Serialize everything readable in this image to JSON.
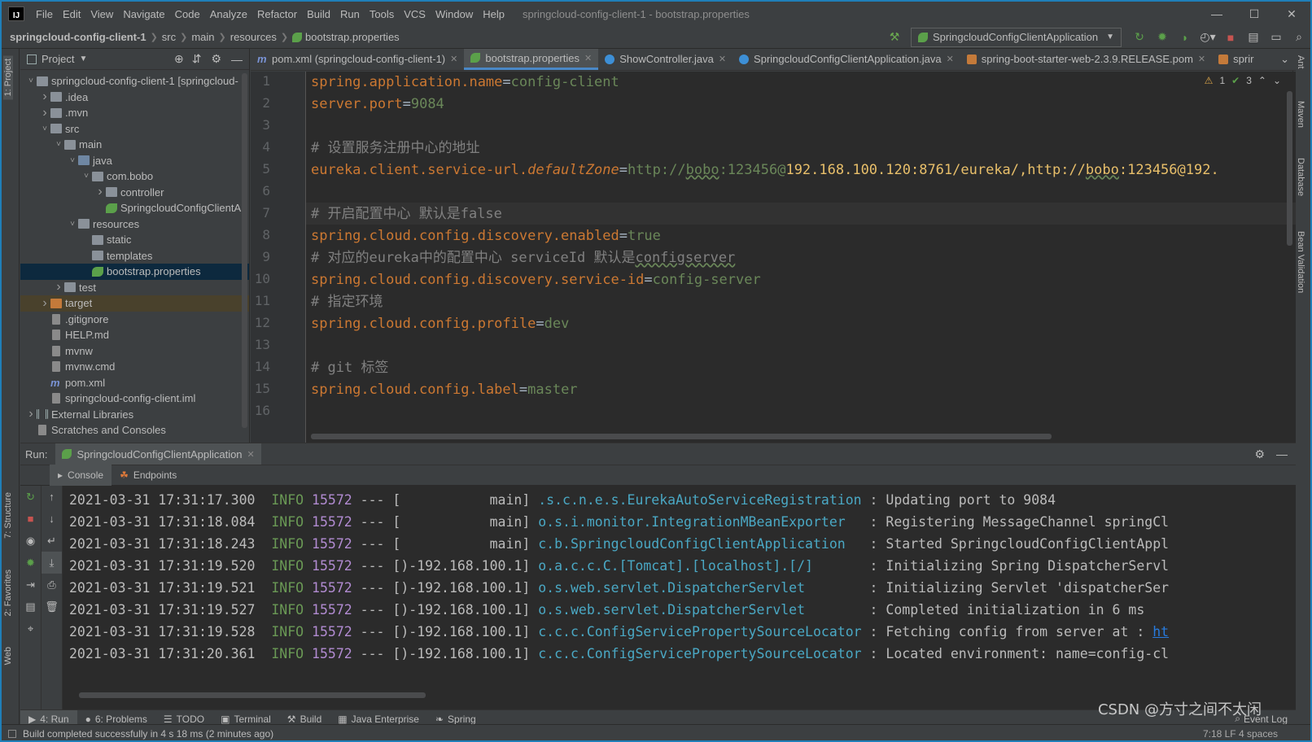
{
  "app": {
    "icon_text": "IJ",
    "window_title": "springcloud-config-client-1 - bootstrap.properties"
  },
  "menu": [
    "File",
    "Edit",
    "View",
    "Navigate",
    "Code",
    "Analyze",
    "Refactor",
    "Build",
    "Run",
    "Tools",
    "VCS",
    "Window",
    "Help"
  ],
  "breadcrumb": [
    "springcloud-config-client-1",
    "src",
    "main",
    "resources",
    "bootstrap.properties"
  ],
  "run_config": "SpringcloudConfigClientApplication",
  "project_panel": {
    "title": "Project",
    "tree": [
      {
        "label": "springcloud-config-client-1 [springcloud-",
        "depth": 0,
        "arrow": "v",
        "icon": "folder"
      },
      {
        "label": ".idea",
        "depth": 1,
        "arrow": ">",
        "icon": "folder"
      },
      {
        "label": ".mvn",
        "depth": 1,
        "arrow": ">",
        "icon": "folder"
      },
      {
        "label": "src",
        "depth": 1,
        "arrow": "v",
        "icon": "folder"
      },
      {
        "label": "main",
        "depth": 2,
        "arrow": "v",
        "icon": "folder"
      },
      {
        "label": "java",
        "depth": 3,
        "arrow": "v",
        "icon": "src"
      },
      {
        "label": "com.bobo",
        "depth": 4,
        "arrow": "v",
        "icon": "folder"
      },
      {
        "label": "controller",
        "depth": 5,
        "arrow": ">",
        "icon": "folder"
      },
      {
        "label": "SpringcloudConfigClientAp",
        "depth": 5,
        "arrow": "",
        "icon": "leaf"
      },
      {
        "label": "resources",
        "depth": 3,
        "arrow": "v",
        "icon": "folder"
      },
      {
        "label": "static",
        "depth": 4,
        "arrow": "",
        "icon": "folder"
      },
      {
        "label": "templates",
        "depth": 4,
        "arrow": "",
        "icon": "folder"
      },
      {
        "label": "bootstrap.properties",
        "depth": 4,
        "arrow": "",
        "icon": "leaf",
        "selected": true
      },
      {
        "label": "test",
        "depth": 2,
        "arrow": ">",
        "icon": "folder"
      },
      {
        "label": "target",
        "depth": 1,
        "arrow": ">",
        "icon": "orange",
        "excluded": true
      },
      {
        "label": ".gitignore",
        "depth": 1,
        "arrow": "",
        "icon": "file"
      },
      {
        "label": "HELP.md",
        "depth": 1,
        "arrow": "",
        "icon": "file"
      },
      {
        "label": "mvnw",
        "depth": 1,
        "arrow": "",
        "icon": "file"
      },
      {
        "label": "mvnw.cmd",
        "depth": 1,
        "arrow": "",
        "icon": "file"
      },
      {
        "label": "pom.xml",
        "depth": 1,
        "arrow": "",
        "icon": "mvn"
      },
      {
        "label": "springcloud-config-client.iml",
        "depth": 1,
        "arrow": "",
        "icon": "file"
      },
      {
        "label": "External Libraries",
        "depth": 0,
        "arrow": ">",
        "icon": "lib"
      },
      {
        "label": "Scratches and Consoles",
        "depth": 0,
        "arrow": "",
        "icon": "file"
      }
    ]
  },
  "editor_tabs": [
    {
      "label": "pom.xml (springcloud-config-client-1)",
      "icon": "m",
      "active": false
    },
    {
      "label": "bootstrap.properties",
      "icon": "leaf",
      "active": true
    },
    {
      "label": "ShowController.java",
      "icon": "c",
      "active": false
    },
    {
      "label": "SpringcloudConfigClientApplication.java",
      "icon": "c",
      "active": false
    },
    {
      "label": "spring-boot-starter-web-2.3.9.RELEASE.pom",
      "icon": "pom",
      "active": false
    },
    {
      "label": "sprir",
      "icon": "pom",
      "active": false
    }
  ],
  "editor_status": {
    "warnings": "1",
    "checks": "3"
  },
  "code_lines": [
    {
      "n": "1",
      "parts": [
        [
          "k",
          "spring.application.name"
        ],
        [
          "eq",
          "="
        ],
        [
          "v",
          "config-client"
        ]
      ]
    },
    {
      "n": "2",
      "parts": [
        [
          "k",
          "server.port"
        ],
        [
          "eq",
          "="
        ],
        [
          "v",
          "9084"
        ]
      ]
    },
    {
      "n": "3",
      "parts": []
    },
    {
      "n": "4",
      "parts": [
        [
          "c",
          "# 设置服务注册中心的地址"
        ]
      ]
    },
    {
      "n": "5",
      "parts": [
        [
          "k",
          "eureka.client.service-url."
        ],
        [
          "it",
          "defaultZone"
        ],
        [
          "eq",
          "="
        ],
        [
          "v",
          "http://"
        ],
        [
          "vu",
          "bobo"
        ],
        [
          "v",
          ":123456@"
        ],
        [
          "y",
          "192.168.100.120:8761/eureka/,http://"
        ],
        [
          "yu",
          "bobo"
        ],
        [
          "y",
          ":123456@192."
        ]
      ]
    },
    {
      "n": "6",
      "parts": []
    },
    {
      "n": "7",
      "parts": [
        [
          "c",
          "# 开启配置中心 默认是false"
        ]
      ]
    },
    {
      "n": "8",
      "parts": [
        [
          "k",
          "spring.cloud.config.discovery.enabled"
        ],
        [
          "eq",
          "="
        ],
        [
          "v",
          "true"
        ]
      ]
    },
    {
      "n": "9",
      "parts": [
        [
          "c",
          "# 对应的eureka中的配置中心 serviceId 默认是"
        ],
        [
          "cu",
          "configserver"
        ]
      ]
    },
    {
      "n": "10",
      "parts": [
        [
          "k",
          "spring.cloud.config.discovery.service-id"
        ],
        [
          "eq",
          "="
        ],
        [
          "v",
          "config-server"
        ]
      ]
    },
    {
      "n": "11",
      "parts": [
        [
          "c",
          "# 指定环境"
        ]
      ]
    },
    {
      "n": "12",
      "parts": [
        [
          "k",
          "spring.cloud.config.profile"
        ],
        [
          "eq",
          "="
        ],
        [
          "v",
          "dev"
        ]
      ]
    },
    {
      "n": "13",
      "parts": []
    },
    {
      "n": "14",
      "parts": [
        [
          "c",
          "# git 标签"
        ]
      ]
    },
    {
      "n": "15",
      "parts": [
        [
          "k",
          "spring.cloud.config.label"
        ],
        [
          "eq",
          "="
        ],
        [
          "v",
          "master"
        ]
      ]
    },
    {
      "n": "16",
      "parts": []
    }
  ],
  "run_panel": {
    "label": "Run:",
    "tab": "SpringcloudConfigClientApplication",
    "subtabs": [
      "Console",
      "Endpoints"
    ]
  },
  "log_lines": [
    {
      "ts": "2021-03-31 17:31:17.300",
      "lvl": "INFO",
      "pid": "15572",
      "sep": "---",
      "thread": "[           main]",
      "logger": ".s.c.n.e.s.EurekaAutoServiceRegistration",
      "msg": ": Updating port to 9084",
      "link": ""
    },
    {
      "ts": "2021-03-31 17:31:18.084",
      "lvl": "INFO",
      "pid": "15572",
      "sep": "---",
      "thread": "[           main]",
      "logger": "o.s.i.monitor.IntegrationMBeanExporter  ",
      "msg": ": Registering MessageChannel springCl",
      "link": ""
    },
    {
      "ts": "2021-03-31 17:31:18.243",
      "lvl": "INFO",
      "pid": "15572",
      "sep": "---",
      "thread": "[           main]",
      "logger": "c.b.SpringcloudConfigClientApplication  ",
      "msg": ": Started SpringcloudConfigClientAppl",
      "link": ""
    },
    {
      "ts": "2021-03-31 17:31:19.520",
      "lvl": "INFO",
      "pid": "15572",
      "sep": "---",
      "thread": "[)-192.168.100.1]",
      "logger": "o.a.c.c.C.[Tomcat].[localhost].[/]      ",
      "msg": ": Initializing Spring DispatcherServl",
      "link": ""
    },
    {
      "ts": "2021-03-31 17:31:19.521",
      "lvl": "INFO",
      "pid": "15572",
      "sep": "---",
      "thread": "[)-192.168.100.1]",
      "logger": "o.s.web.servlet.DispatcherServlet       ",
      "msg": ": Initializing Servlet 'dispatcherSer",
      "link": ""
    },
    {
      "ts": "2021-03-31 17:31:19.527",
      "lvl": "INFO",
      "pid": "15572",
      "sep": "---",
      "thread": "[)-192.168.100.1]",
      "logger": "o.s.web.servlet.DispatcherServlet       ",
      "msg": ": Completed initialization in 6 ms",
      "link": ""
    },
    {
      "ts": "2021-03-31 17:31:19.528",
      "lvl": "INFO",
      "pid": "15572",
      "sep": "---",
      "thread": "[)-192.168.100.1]",
      "logger": "c.c.c.ConfigServicePropertySourceLocator",
      "msg": ": Fetching config from server at : ",
      "link": "ht"
    },
    {
      "ts": "2021-03-31 17:31:20.361",
      "lvl": "INFO",
      "pid": "15572",
      "sep": "---",
      "thread": "[)-192.168.100.1]",
      "logger": "c.c.c.ConfigServicePropertySourceLocator",
      "msg": ": Located environment: name=config-cl",
      "link": ""
    }
  ],
  "bottom_tabs": [
    {
      "label": "4: Run",
      "active": true,
      "icon": "▶"
    },
    {
      "label": "6: Problems",
      "active": false,
      "icon": "●"
    },
    {
      "label": "TODO",
      "active": false,
      "icon": "☰"
    },
    {
      "label": "Terminal",
      "active": false,
      "icon": "▣"
    },
    {
      "label": "Build",
      "active": false,
      "icon": "⚒"
    },
    {
      "label": "Java Enterprise",
      "active": false,
      "icon": "▦"
    },
    {
      "label": "Spring",
      "active": false,
      "icon": "❧"
    }
  ],
  "event_log": "Event Log",
  "status": "Build completed successfully in 4 s 18 ms (2 minutes ago)",
  "status_right": "7:18   LF   4 spaces",
  "left_strip": [
    "1: Project",
    "7: Structure",
    "2: Favorites",
    "Web"
  ],
  "right_strip": [
    "Ant",
    "Maven",
    "Database",
    "Bean Validation"
  ],
  "watermark": "CSDN @方寸之间不太闲"
}
